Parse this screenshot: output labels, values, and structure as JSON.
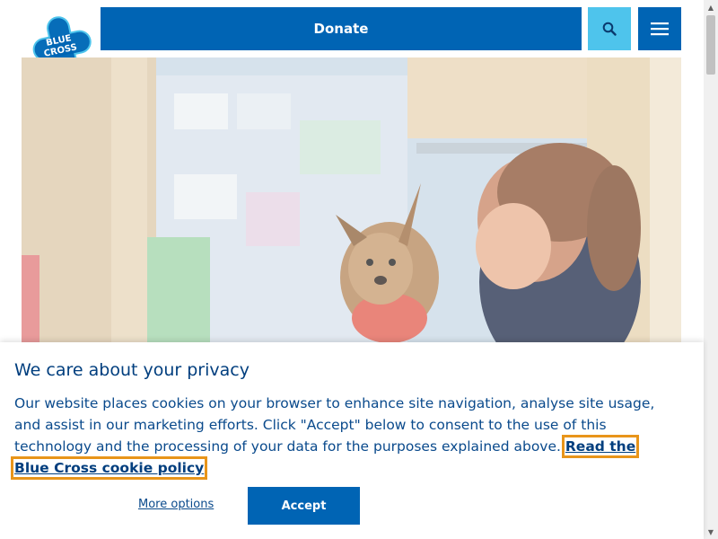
{
  "header": {
    "logo_text_line1": "BLUE",
    "logo_text_line2": "CROSS",
    "donate_label": "Donate",
    "colors": {
      "primary": "#0064b4",
      "search_bg": "#4ec4ec"
    },
    "search_icon": "search-icon",
    "menu_icon": "hamburger-menu-icon"
  },
  "hero": {
    "image_subject": "photo-woman-with-terrier-dog"
  },
  "cookie_banner": {
    "title": "We care about your privacy",
    "body": "Our website places cookies on your browser to enhance site navigation, analyse site usage, and assist in our marketing efforts. Click \"Accept\" below to consent to the use of this technology and the processing of your data for the purposes explained above. ",
    "policy_link": "Read the Blue Cross cookie policy",
    "more_options_label": "More options",
    "accept_label": "Accept",
    "focus_outline_color": "#e8951a"
  }
}
